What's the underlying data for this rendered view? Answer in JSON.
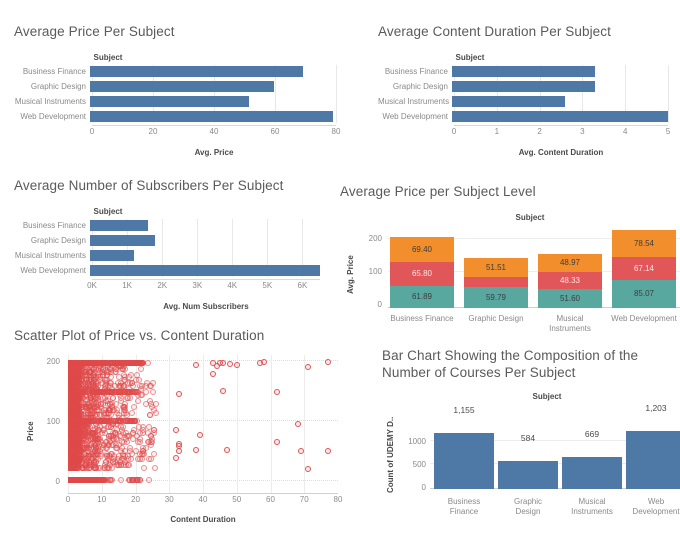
{
  "colors": {
    "bar_blue": "#4e79a7",
    "stack_orange": "#f28e2b",
    "stack_red": "#e15759",
    "stack_teal": "#59a8a0",
    "scatter_red": "#e04a4a",
    "title_gray": "#5a5a5a",
    "tick_gray": "#8a8a8a"
  },
  "charts": [
    {
      "id": "avg-price-per-subject",
      "title": "Average Price Per Subject",
      "column_header": "Subject",
      "xlabel": "Avg. Price"
    },
    {
      "id": "avg-content-duration-per-subject",
      "title": "Average Content Duration Per Subject",
      "column_header": "Subject",
      "xlabel": "Avg. Content Duration"
    },
    {
      "id": "avg-subscribers-per-subject",
      "title": "Average Number of Subscribers Per Subject",
      "column_header": "Subject",
      "xlabel": "Avg. Num Subscribers"
    },
    {
      "id": "avg-price-per-subject-level",
      "title": "Average Price per Subject Level",
      "column_header": "Subject",
      "ylabel": "Avg. Price"
    },
    {
      "id": "scatter-price-vs-duration",
      "title": "Scatter Plot of Price vs. Content Duration",
      "xlabel": "Content Duration",
      "ylabel": "Price"
    },
    {
      "id": "course-composition",
      "title": "Bar Chart Showing the Composition of the Number of Courses Per Subject",
      "column_header": "Subject",
      "ylabel": "Count of UDEMY D.."
    }
  ],
  "chart_data": [
    {
      "type": "bar",
      "orientation": "horizontal",
      "id": "avg-price-per-subject",
      "title": "Average Price Per Subject",
      "xlabel": "Avg. Price",
      "ylabel": "Subject",
      "categories": [
        "Business Finance",
        "Graphic Design",
        "Musical Instruments",
        "Web Development"
      ],
      "values": [
        69.4,
        59.8,
        51.6,
        79.0
      ],
      "xlim": [
        0,
        80
      ],
      "xticks": [
        0,
        20,
        40,
        60,
        80
      ],
      "xticklabels": [
        "0",
        "20",
        "40",
        "60",
        "80"
      ],
      "grid": true,
      "color": "#4e79a7"
    },
    {
      "type": "bar",
      "orientation": "horizontal",
      "id": "avg-content-duration-per-subject",
      "title": "Average Content Duration Per Subject",
      "xlabel": "Avg. Content Duration",
      "ylabel": "Subject",
      "categories": [
        "Business Finance",
        "Graphic Design",
        "Musical Instruments",
        "Web Development"
      ],
      "values": [
        3.63,
        3.64,
        2.87,
        5.55
      ],
      "xlim": [
        0,
        5.5
      ],
      "xticks": [
        0,
        1,
        2,
        3,
        4,
        5
      ],
      "xticklabels": [
        "0",
        "1",
        "2",
        "3",
        "4",
        "5"
      ],
      "grid": true,
      "color": "#4e79a7"
    },
    {
      "type": "bar",
      "orientation": "horizontal",
      "id": "avg-subscribers-per-subject",
      "title": "Average Number of Subscribers Per Subject",
      "xlabel": "Avg. Num Subscribers",
      "ylabel": "Subject",
      "categories": [
        "Business Finance",
        "Graphic Design",
        "Musical Instruments",
        "Web Development"
      ],
      "values": [
        1650,
        1830,
        1250,
        6500
      ],
      "xlim": [
        0,
        6500
      ],
      "xticks": [
        0,
        1000,
        2000,
        3000,
        4000,
        5000,
        6000
      ],
      "xticklabels": [
        "0K",
        "1K",
        "2K",
        "3K",
        "4K",
        "5K",
        "6K"
      ],
      "grid": true,
      "color": "#4e79a7"
    },
    {
      "type": "bar",
      "stacked": true,
      "orientation": "vertical",
      "id": "avg-price-per-subject-level",
      "title": "Average Price per Subject Level",
      "xlabel": "Subject",
      "ylabel": "Avg. Price",
      "categories": [
        "Business Finance",
        "Graphic Design",
        "Musical Instruments",
        "Web Development"
      ],
      "yticks": [
        0,
        100,
        200
      ],
      "yticklabels": [
        "0",
        "100",
        "200"
      ],
      "ylim": [
        0,
        232
      ],
      "series": [
        {
          "name": "level-bottom",
          "color": "#59a8a0",
          "values": [
            61.89,
            59.79,
            51.6,
            85.07
          ],
          "labels": [
            "61.89",
            "59.79",
            "51.60",
            "85.07"
          ]
        },
        {
          "name": "level-middle",
          "color": "#e15759",
          "values": [
            65.8,
            28.5,
            48.33,
            67.14
          ],
          "labels": [
            "65.80",
            "",
            "48.33",
            "67.14"
          ]
        },
        {
          "name": "level-top",
          "color": "#f28e2b",
          "values": [
            69.4,
            51.51,
            48.97,
            78.54
          ],
          "labels": [
            "69.40",
            "51.51",
            "48.97",
            "78.54"
          ]
        }
      ]
    },
    {
      "type": "scatter",
      "id": "scatter-price-vs-duration",
      "title": "Scatter Plot of Price vs. Content Duration",
      "xlabel": "Content Duration",
      "ylabel": "Price",
      "xlim": [
        0,
        80
      ],
      "ylim": [
        0,
        205
      ],
      "xticks": [
        0,
        10,
        20,
        30,
        40,
        50,
        60,
        70,
        80
      ],
      "xticklabels": [
        "0",
        "10",
        "20",
        "30",
        "40",
        "50",
        "60",
        "70",
        "80"
      ],
      "yticks": [
        0,
        100,
        200
      ],
      "yticklabels": [
        "0",
        "100",
        "200"
      ],
      "marker": "open-circle",
      "color": "#e04a4a",
      "notable_points": [
        [
          38,
          196
        ],
        [
          43,
          200
        ],
        [
          44,
          195
        ],
        [
          45,
          200
        ],
        [
          46,
          199
        ],
        [
          48,
          198
        ],
        [
          50,
          196
        ],
        [
          57,
          200
        ],
        [
          58,
          201
        ],
        [
          71,
          192
        ],
        [
          77,
          201
        ],
        [
          43,
          181
        ],
        [
          46,
          151
        ],
        [
          62,
          150
        ],
        [
          33,
          147
        ],
        [
          32,
          85
        ],
        [
          39,
          76
        ],
        [
          33,
          62
        ],
        [
          33,
          58
        ],
        [
          38,
          51
        ],
        [
          47,
          51
        ],
        [
          62,
          65
        ],
        [
          68,
          96
        ],
        [
          69,
          50
        ],
        [
          71,
          19
        ],
        [
          77,
          50
        ],
        [
          32,
          37
        ],
        [
          33,
          50
        ]
      ]
    },
    {
      "type": "bar",
      "orientation": "vertical",
      "id": "course-composition",
      "title": "Bar Chart Showing the Composition of the Number of Courses Per Subject",
      "xlabel": "Subject",
      "ylabel": "Count of UDEMY D..",
      "categories": [
        "Business\nFinance",
        "Graphic\nDesign",
        "Musical\nInstruments",
        "Web\nDevelopment"
      ],
      "values": [
        1155,
        584,
        669,
        1203
      ],
      "value_labels": [
        "1,155",
        "584",
        "669",
        "1,203"
      ],
      "ylim": [
        0,
        1260
      ],
      "yticks": [
        0,
        500,
        1000
      ],
      "yticklabels": [
        "0",
        "500",
        "1000"
      ],
      "color": "#4e79a7"
    }
  ]
}
